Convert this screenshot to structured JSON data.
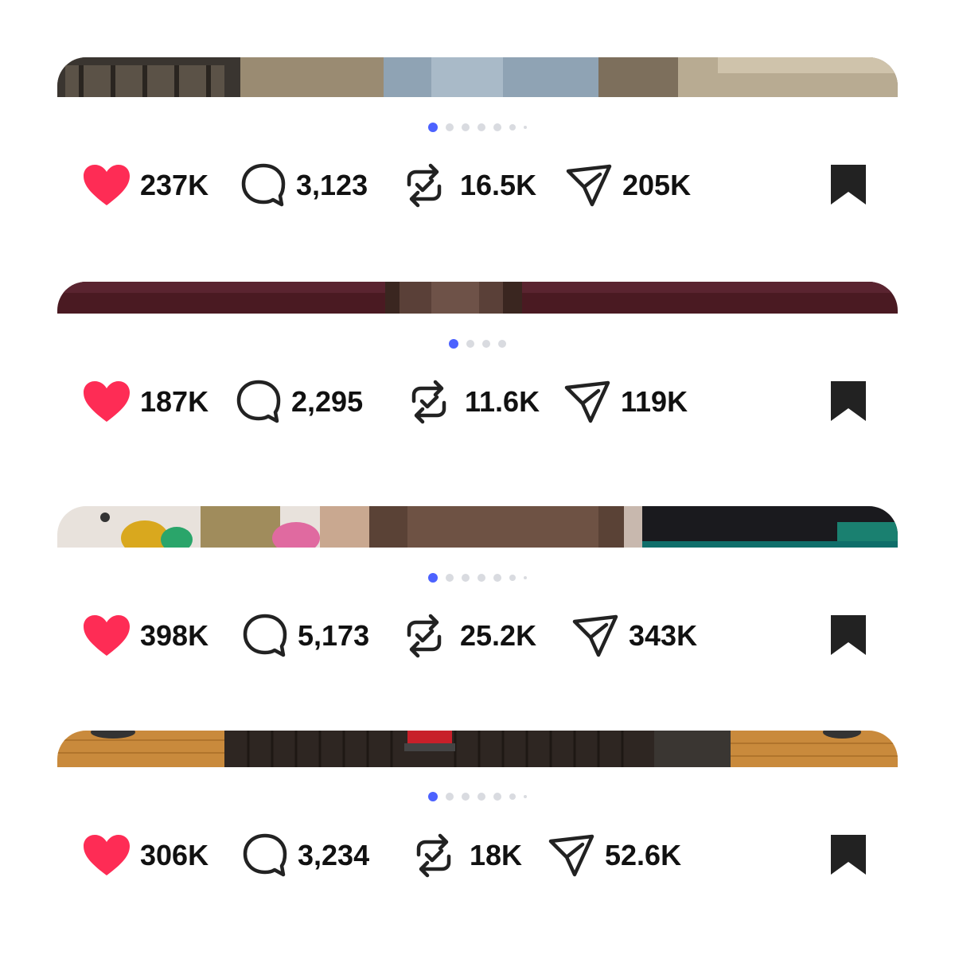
{
  "posts": [
    {
      "dots": {
        "total": 7,
        "active": 0
      },
      "likes": "237K",
      "comments": "3,123",
      "reposts": "16.5K",
      "shares": "205K"
    },
    {
      "dots": {
        "total": 4,
        "active": 0
      },
      "likes": "187K",
      "comments": "2,295",
      "reposts": "11.6K",
      "shares": "119K"
    },
    {
      "dots": {
        "total": 7,
        "active": 0
      },
      "likes": "398K",
      "comments": "5,173",
      "reposts": "25.2K",
      "shares": "343K"
    },
    {
      "dots": {
        "total": 7,
        "active": 0
      },
      "likes": "306K",
      "comments": "3,234",
      "reposts": "18K",
      "shares": "52.6K"
    }
  ],
  "icons": {
    "like": "heart-icon",
    "comment": "comment-bubble-icon",
    "repost": "repost-icon",
    "share": "send-icon",
    "save": "bookmark-icon"
  },
  "colors": {
    "like": "#fe2c55",
    "active_dot": "#4c62ff",
    "inactive_dot": "#d9dbe0",
    "icon": "#222222"
  }
}
